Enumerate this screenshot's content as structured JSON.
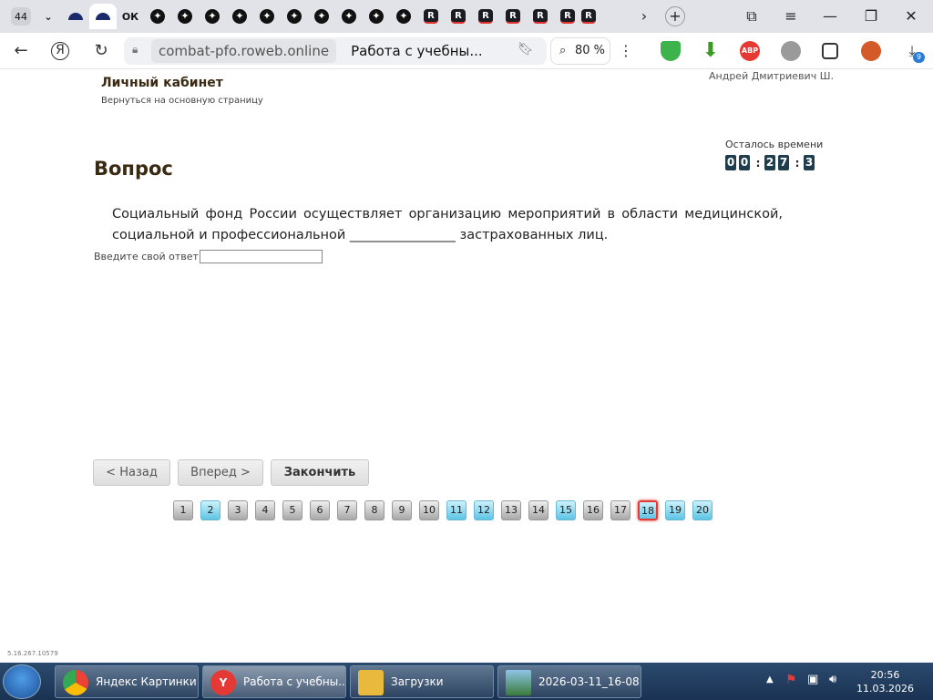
{
  "browser": {
    "tab_count_badge": "44",
    "tab_ok_label": "ОК",
    "tab_r_label": "R",
    "url_host": "combat-pfo.roweb.online",
    "page_title": "Работа с учебны...",
    "zoom": "80 %",
    "download_badge": "9",
    "abp_label": "ABP"
  },
  "header": {
    "cabinet_title": "Личный кабинет",
    "back_link": "Вернуться на основную страницу",
    "user_name": "Андрей Дмитриевич Ш."
  },
  "timer": {
    "label": "Осталось времени",
    "digits": [
      "0",
      "0",
      "2",
      "7",
      "3"
    ]
  },
  "question": {
    "heading": "Вопрос",
    "text": "Социальный фонд России осуществляет организацию мероприятий в области медицинской, социальной и профессиональной ________________ застрахованных лиц.",
    "answer_label": "Введите свой ответ",
    "answer_value": ""
  },
  "buttons": {
    "back": "< Назад",
    "forward": "Вперед >",
    "finish": "Закончить"
  },
  "pagination": {
    "pages": [
      "1",
      "2",
      "3",
      "4",
      "5",
      "6",
      "7",
      "8",
      "9",
      "10",
      "11",
      "12",
      "13",
      "14",
      "15",
      "16",
      "17",
      "18",
      "19",
      "20"
    ],
    "answered": [
      "2",
      "11",
      "12",
      "15",
      "19",
      "20"
    ],
    "current": "18"
  },
  "status_ip": "5.16.267.10579",
  "taskbar": {
    "items": [
      "Яндекс Картинки...",
      "Работа с учебны...",
      "Загрузки",
      "2026-03-11_16-08..."
    ],
    "time": "20:56",
    "date": "11.03.2026"
  },
  "colors": {
    "answered_page": "#5dc4e4",
    "current_border": "#e53935",
    "timer_digit": "#1f3d4c",
    "heading": "#3a2a12"
  }
}
